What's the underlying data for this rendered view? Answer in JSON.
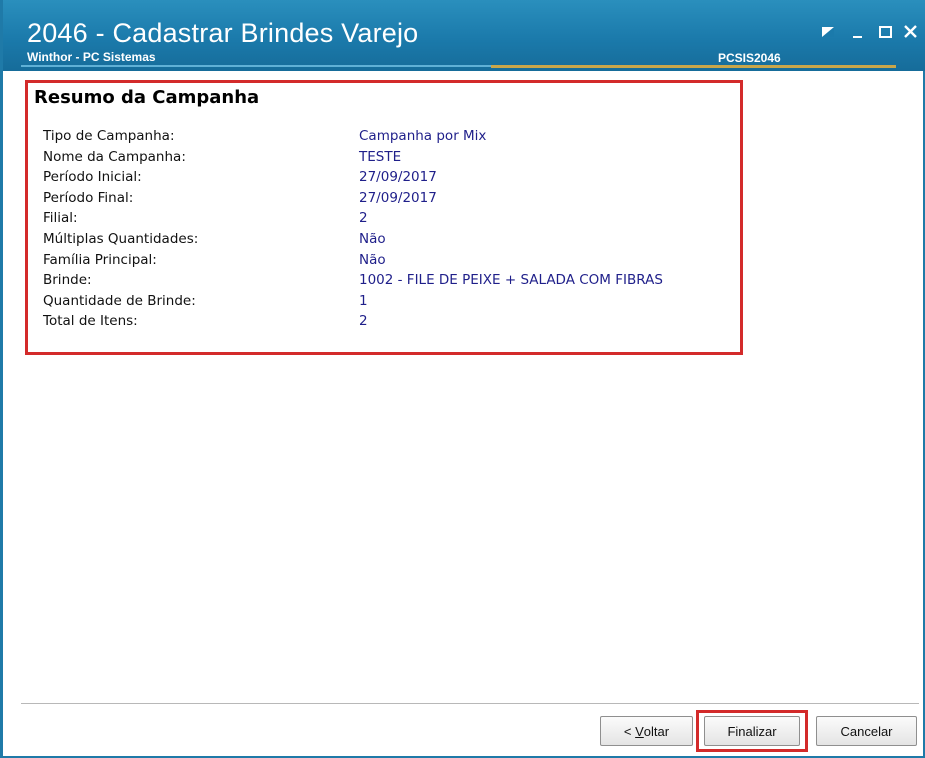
{
  "window": {
    "title": "2046 - Cadastrar Brindes Varejo",
    "subtitle": "Winthor - PC Sistemas",
    "code": "PCSIS2046"
  },
  "summary": {
    "title": "Resumo da Campanha",
    "rows": [
      {
        "label": "Tipo de Campanha:",
        "value": "Campanha por Mix"
      },
      {
        "label": "Nome da Campanha:",
        "value": "TESTE"
      },
      {
        "label": "Período Inicial:",
        "value": "27/09/2017"
      },
      {
        "label": "Período Final:",
        "value": "27/09/2017"
      },
      {
        "label": "Filial:",
        "value": "2"
      },
      {
        "label": "Múltiplas Quantidades:",
        "value": "Não"
      },
      {
        "label": "Família Principal:",
        "value": "Não"
      },
      {
        "label": "Brinde:",
        "value": "1002 - FILE DE PEIXE + SALADA COM FIBRAS"
      },
      {
        "label": "Quantidade de Brinde:",
        "value": "1"
      },
      {
        "label": "Total de Itens:",
        "value": "2"
      }
    ]
  },
  "buttons": {
    "back_prefix": "< ",
    "back_accel": "V",
    "back_rest": "oltar",
    "finish": "Finalizar",
    "cancel": "Cancelar"
  },
  "colors": {
    "titlebar": "#1b7aab",
    "highlight": "#d32a2a",
    "value_text": "#1f1f8a"
  },
  "icons": [
    "restore-icon",
    "minimize-icon",
    "maximize-icon",
    "close-icon"
  ]
}
